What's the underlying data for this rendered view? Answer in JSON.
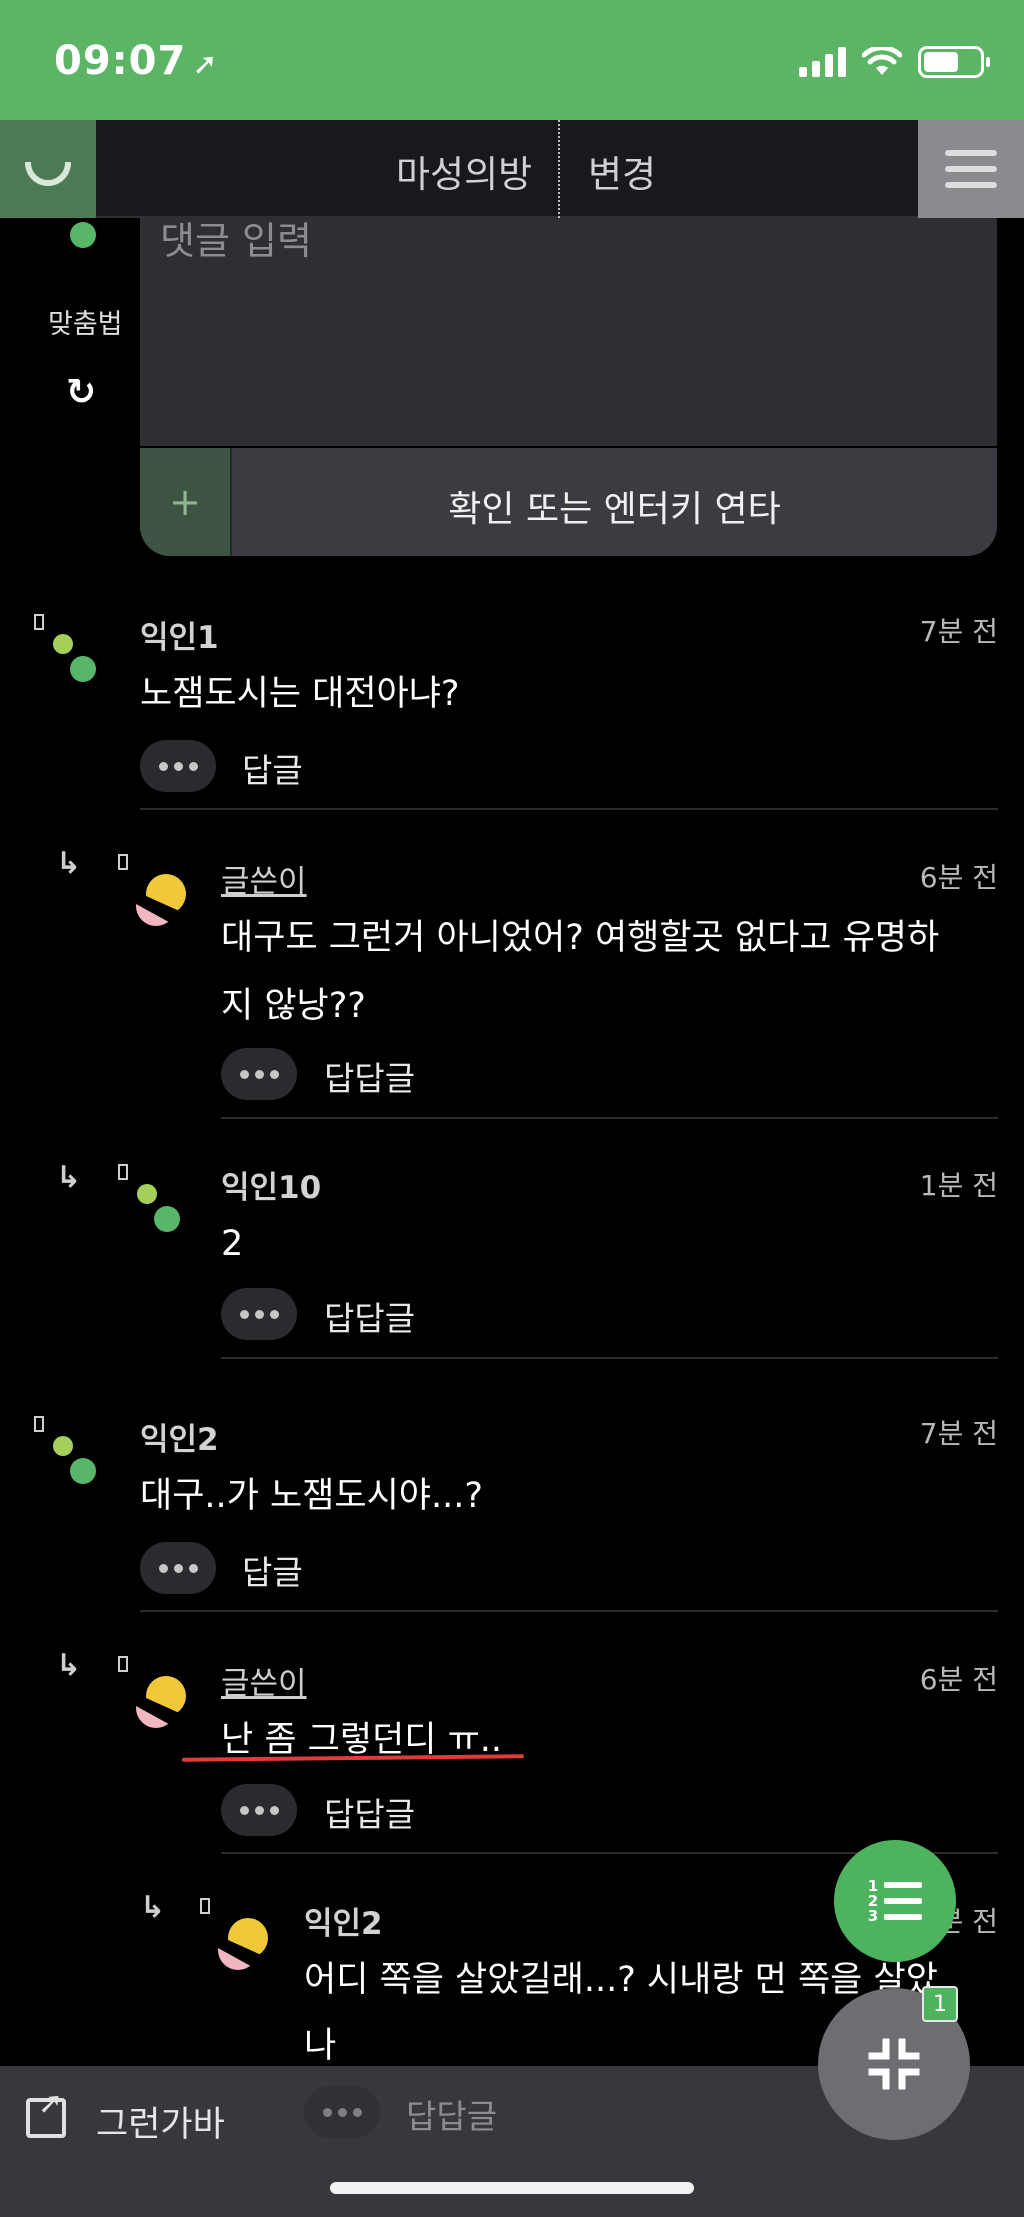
{
  "status_bar": {
    "time": "09:07",
    "location_glyph": "➚",
    "bg": "#5cb564"
  },
  "nav": {
    "title": "마성의방",
    "change_label": "변경"
  },
  "composer": {
    "placeholder": "댓글 입력",
    "spell_label": "맞춤법",
    "refresh_glyph": "↻",
    "plus_glyph": "+",
    "submit_label": "확인 또는 엔터키 연타"
  },
  "comments": [
    {
      "name": "익인1",
      "time": "7분 전",
      "text": "노잼도시는 대전아냐?",
      "reply_label": "답글"
    },
    {
      "name": "글쓴이",
      "time": "6분 전",
      "text_line1": "대구도 그런거 아니었어? 여행할곳 없다고 유명하",
      "text_line2": "지 않낭??",
      "reply_label": "답답글"
    },
    {
      "name": "익인10",
      "time": "1분 전",
      "text": "2",
      "reply_label": "답답글"
    },
    {
      "name": "익인2",
      "time": "7분 전",
      "text": "대구..가 노잼도시야...?",
      "reply_label": "답글"
    },
    {
      "name": "글쓴이",
      "time": "6분 전",
      "text": "난 좀 그렇던디 ㅠ..",
      "reply_label": "답답글"
    },
    {
      "name": "익인2",
      "time": "1분 전",
      "text_line1": "어디 쪽을 살았길래...? 시내랑 먼 쪽을 살았",
      "text_line2": "나",
      "reply_label": "답답글"
    }
  ],
  "reply_arrow_glyph": "↳",
  "fab": {
    "list_numbers": "1\n2\n3",
    "badge": "1",
    "shrink_glyph": "⤡"
  },
  "bottom_bar": {
    "label": "그런가바"
  },
  "colors": {
    "accent_green": "#4db35e",
    "highlight_red": "#e23b3b"
  }
}
